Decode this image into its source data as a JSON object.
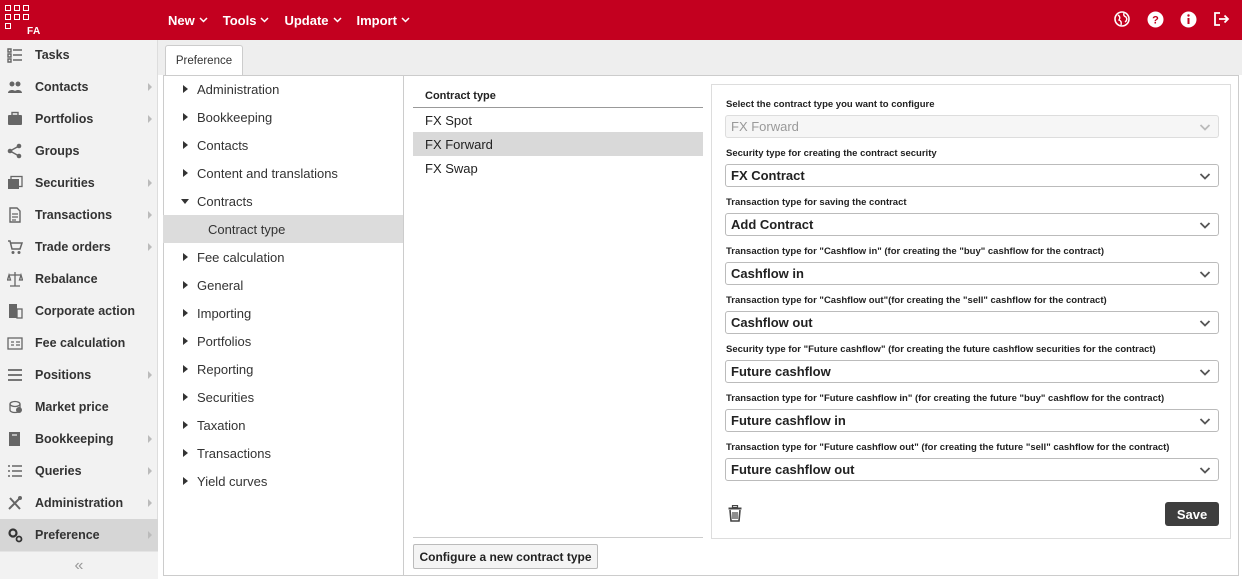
{
  "app": {
    "logo_text": "FA"
  },
  "topmenu": [
    {
      "label": "New"
    },
    {
      "label": "Tools"
    },
    {
      "label": "Update"
    },
    {
      "label": "Import"
    }
  ],
  "topicons": [
    "globe-icon",
    "help-icon",
    "info-icon",
    "logout-icon"
  ],
  "sidebar": {
    "items": [
      {
        "label": "Tasks",
        "icon": "tasks-icon",
        "arrow": false
      },
      {
        "label": "Contacts",
        "icon": "contacts-icon",
        "arrow": true
      },
      {
        "label": "Portfolios",
        "icon": "portfolios-icon",
        "arrow": true
      },
      {
        "label": "Groups",
        "icon": "groups-icon",
        "arrow": false
      },
      {
        "label": "Securities",
        "icon": "securities-icon",
        "arrow": true
      },
      {
        "label": "Transactions",
        "icon": "transactions-icon",
        "arrow": true
      },
      {
        "label": "Trade orders",
        "icon": "cart-icon",
        "arrow": true
      },
      {
        "label": "Rebalance",
        "icon": "scale-icon",
        "arrow": false
      },
      {
        "label": "Corporate action",
        "icon": "building-icon",
        "arrow": false
      },
      {
        "label": "Fee calculation",
        "icon": "fee-icon",
        "arrow": false
      },
      {
        "label": "Positions",
        "icon": "positions-icon",
        "arrow": true
      },
      {
        "label": "Market price",
        "icon": "market-price-icon",
        "arrow": false
      },
      {
        "label": "Bookkeeping",
        "icon": "book-icon",
        "arrow": true
      },
      {
        "label": "Queries",
        "icon": "queries-icon",
        "arrow": true
      },
      {
        "label": "Administration",
        "icon": "tools-icon",
        "arrow": true
      },
      {
        "label": "Preference",
        "icon": "gears-icon",
        "arrow": true,
        "active": true
      }
    ],
    "collapse": "«"
  },
  "tab": {
    "label": "Preference"
  },
  "tree": {
    "items": [
      {
        "label": "Administration"
      },
      {
        "label": "Bookkeeping"
      },
      {
        "label": "Contacts"
      },
      {
        "label": "Content and translations"
      },
      {
        "label": "Contracts",
        "open": true
      },
      {
        "label": "Contract type",
        "child": true
      },
      {
        "label": "Fee calculation"
      },
      {
        "label": "General"
      },
      {
        "label": "Importing"
      },
      {
        "label": "Portfolios"
      },
      {
        "label": "Reporting"
      },
      {
        "label": "Securities"
      },
      {
        "label": "Taxation"
      },
      {
        "label": "Transactions"
      },
      {
        "label": "Yield curves"
      }
    ]
  },
  "contract_list": {
    "header": "Contract type",
    "rows": [
      {
        "label": "FX Spot"
      },
      {
        "label": "FX Forward",
        "selected": true
      },
      {
        "label": "FX Swap"
      }
    ],
    "new_button": "Configure a new contract type"
  },
  "form": {
    "fields": [
      {
        "label": "Select the contract type you want to configure",
        "value": "FX Forward",
        "disabled": true
      },
      {
        "label": "Security type for creating the contract security",
        "value": "FX Contract"
      },
      {
        "label": "Transaction type for saving the contract",
        "value": "Add Contract"
      },
      {
        "label": "Transaction type for \"Cashflow in\" (for creating the \"buy\" cashflow for the contract)",
        "value": "Cashflow in"
      },
      {
        "label": "Transaction type for \"Cashflow out\"(for creating the \"sell\" cashflow for the contract)",
        "value": "Cashflow out"
      },
      {
        "label": "Security type for \"Future cashflow\" (for creating the future cashflow securities for the contract)",
        "value": "Future cashflow"
      },
      {
        "label": "Transaction type for \"Future cashflow in\" (for creating the future \"buy\" cashflow for the contract)",
        "value": "Future cashflow in"
      },
      {
        "label": "Transaction type for \"Future cashflow out\" (for creating the future \"sell\" cashflow for the contract)",
        "value": "Future cashflow out"
      }
    ],
    "save_label": "Save"
  },
  "colors": {
    "brand": "#c3001f",
    "active_bg": "#d6d6d6",
    "save_bg": "#3e3e3e"
  }
}
